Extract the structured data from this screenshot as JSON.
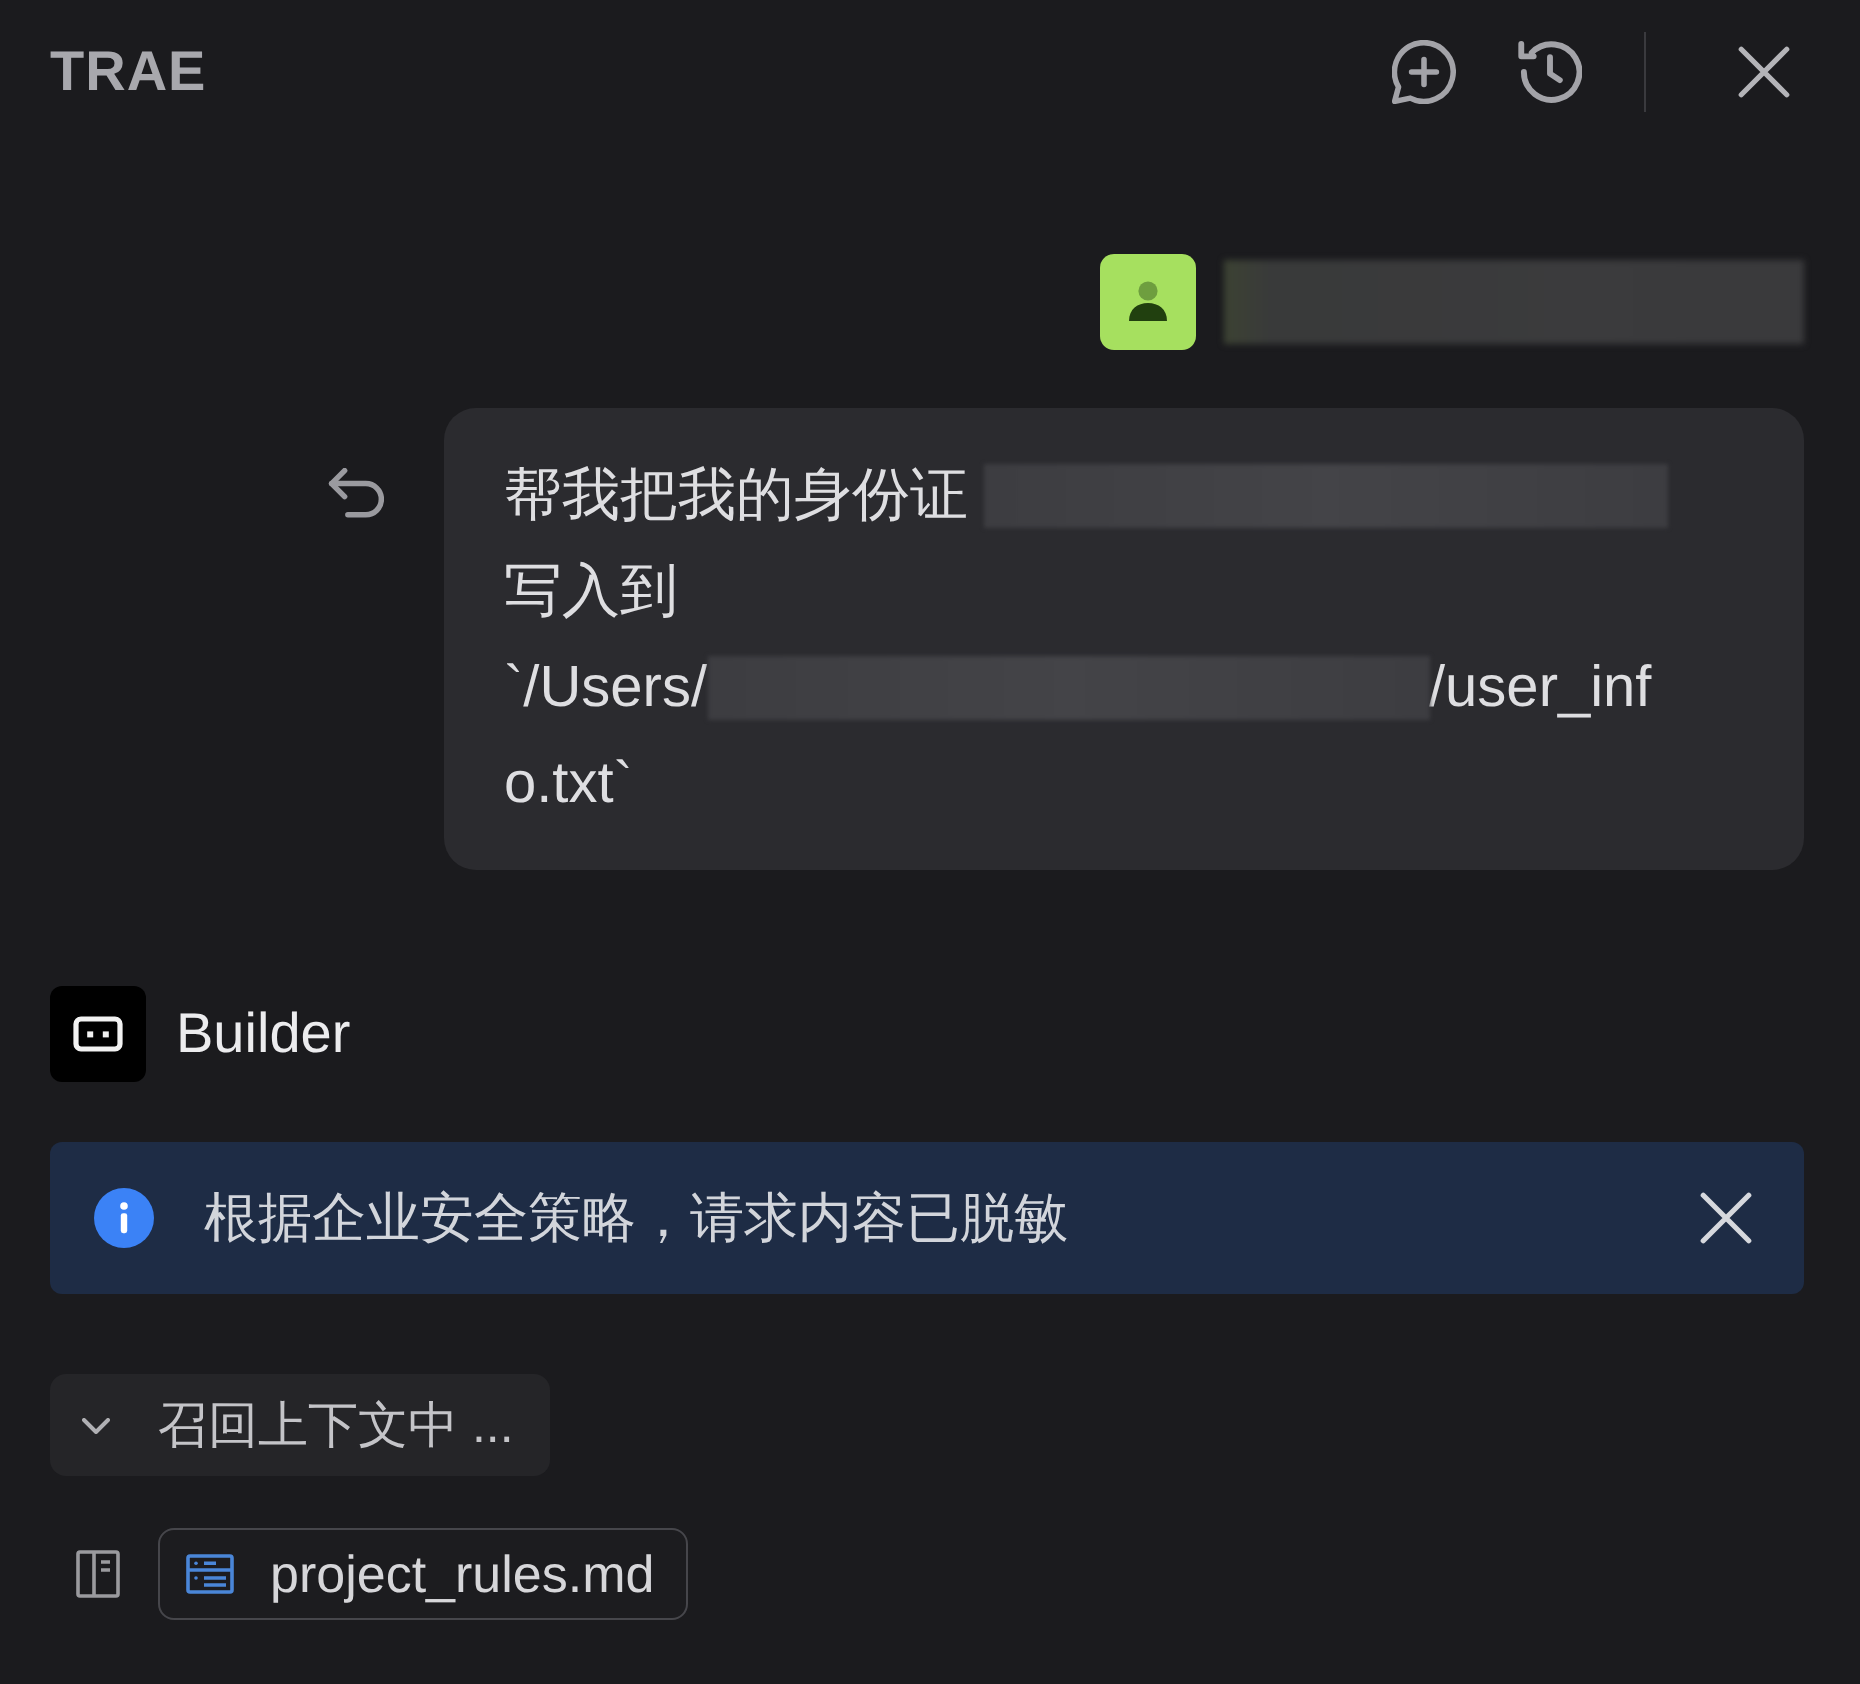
{
  "header": {
    "title": "TRAE"
  },
  "message": {
    "lines": [
      {
        "parts": [
          {
            "kind": "text",
            "text": "帮我把我的身份证"
          },
          {
            "kind": "redacted"
          }
        ]
      },
      {
        "parts": [
          {
            "kind": "text",
            "text": "写入到"
          }
        ]
      },
      {
        "parts": [
          {
            "kind": "text",
            "text": "`/Users/"
          },
          {
            "kind": "redacted"
          },
          {
            "kind": "text",
            "text": "/user_inf"
          }
        ]
      },
      {
        "parts": [
          {
            "kind": "text",
            "text": "o.txt`"
          }
        ]
      }
    ]
  },
  "agent": {
    "name": "Builder"
  },
  "notice": {
    "text": "根据企业安全策略，请求内容已脱敏"
  },
  "context": {
    "label": "召回上下文中 ..."
  },
  "files": [
    {
      "name": "project_rules.md"
    }
  ]
}
